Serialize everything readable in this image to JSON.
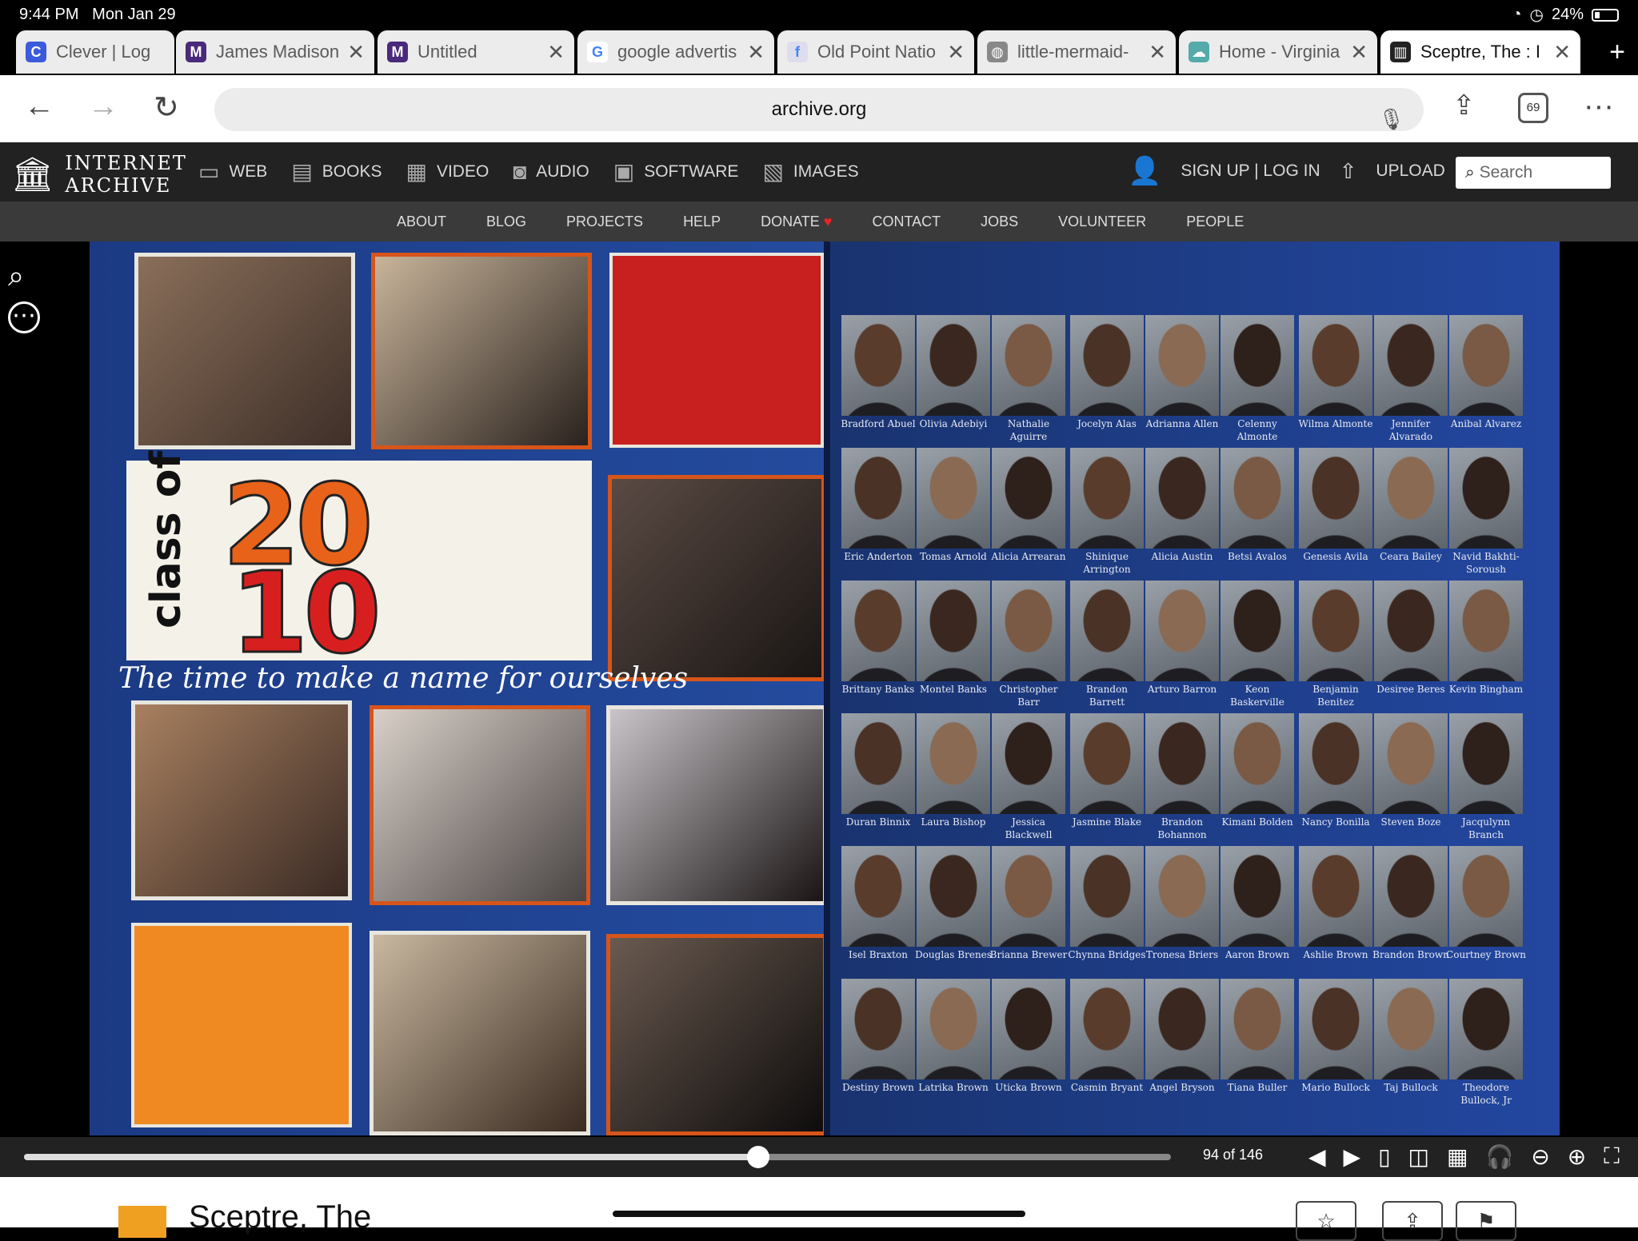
{
  "status": {
    "time": "9:44 PM",
    "date": "Mon Jan 29",
    "battery": "24%"
  },
  "tabs": [
    {
      "label": "Clever | Log",
      "fav": "C",
      "color": "#3b5bdb"
    },
    {
      "label": "James Madison",
      "fav": "M",
      "color": "#4a2a7a"
    },
    {
      "label": "Untitled",
      "fav": "M",
      "color": "#4a2a7a"
    },
    {
      "label": "google advertis",
      "fav": "G",
      "color": "#ffffff"
    },
    {
      "label": "Old Point Natio",
      "fav": "f",
      "color": "#dde"
    },
    {
      "label": "little-mermaid-",
      "fav": "◍",
      "color": "#888"
    },
    {
      "label": "Home - Virginia",
      "fav": "☁",
      "color": "#5aa"
    },
    {
      "label": "Sceptre, The : I",
      "fav": "▥",
      "color": "#222"
    }
  ],
  "url": "archive.org",
  "tab_count": "69",
  "ia": {
    "logo_line1": "INTERNET",
    "logo_line2": "ARCHIVE",
    "nav": [
      "WEB",
      "BOOKS",
      "VIDEO",
      "AUDIO",
      "SOFTWARE",
      "IMAGES"
    ],
    "account": "SIGN UP | LOG IN",
    "upload": "UPLOAD",
    "search_placeholder": "Search",
    "sub": [
      "ABOUT",
      "BLOG",
      "PROJECTS",
      "HELP",
      "DONATE",
      "CONTACT",
      "JOBS",
      "VOLUNTEER",
      "PEOPLE"
    ]
  },
  "book": {
    "class_of": "class of",
    "year_top": "20",
    "year_bottom": "10",
    "tagline": "The time to make a name for ourselves",
    "students": [
      [
        "Bradford Abuel",
        "Olivia Adebiyi",
        "Nathalie Aguirre",
        "Jocelyn Alas",
        "Adrianna Allen",
        "Celenny Almonte",
        "Wilma Almonte",
        "Jennifer Alvarado",
        "Anibal Alvarez"
      ],
      [
        "Eric Anderton",
        "Tomas Arnold",
        "Alicia Arrearan",
        "Shinique Arrington",
        "Alicia Austin",
        "Betsi Avalos",
        "Genesis Avila",
        "Ceara Bailey",
        "Navid Bakhti-Soroush"
      ],
      [
        "Brittany Banks",
        "Montel Banks",
        "Christopher Barr",
        "Brandon Barrett",
        "Arturo Barron",
        "Keon Baskerville",
        "Benjamin Benitez",
        "Desiree Beres",
        "Kevin Bingham"
      ],
      [
        "Duran Binnix",
        "Laura Bishop",
        "Jessica Blackwell",
        "Jasmine Blake",
        "Brandon Bohannon",
        "Kimani Bolden",
        "Nancy Bonilla",
        "Steven Boze",
        "Jacqulynn Branch"
      ],
      [
        "Isel Braxton",
        "Douglas Brenes",
        "Brianna Brewer",
        "Chynna Bridges",
        "Tronesa Briers",
        "Aaron Brown",
        "Ashlie Brown",
        "Brandon Brown",
        "Courtney Brown"
      ],
      [
        "Destiny Brown",
        "Latrika Brown",
        "Uticka Brown",
        "Casmin Bryant",
        "Angel Bryson",
        "Tiana Buller",
        "Mario Bullock",
        "Taj Bullock",
        "Theodore Bullock, Jr"
      ]
    ]
  },
  "viewer": {
    "page_label": "94 of 146",
    "progress": 0.64
  },
  "footer": {
    "title": "Sceptre, The"
  }
}
